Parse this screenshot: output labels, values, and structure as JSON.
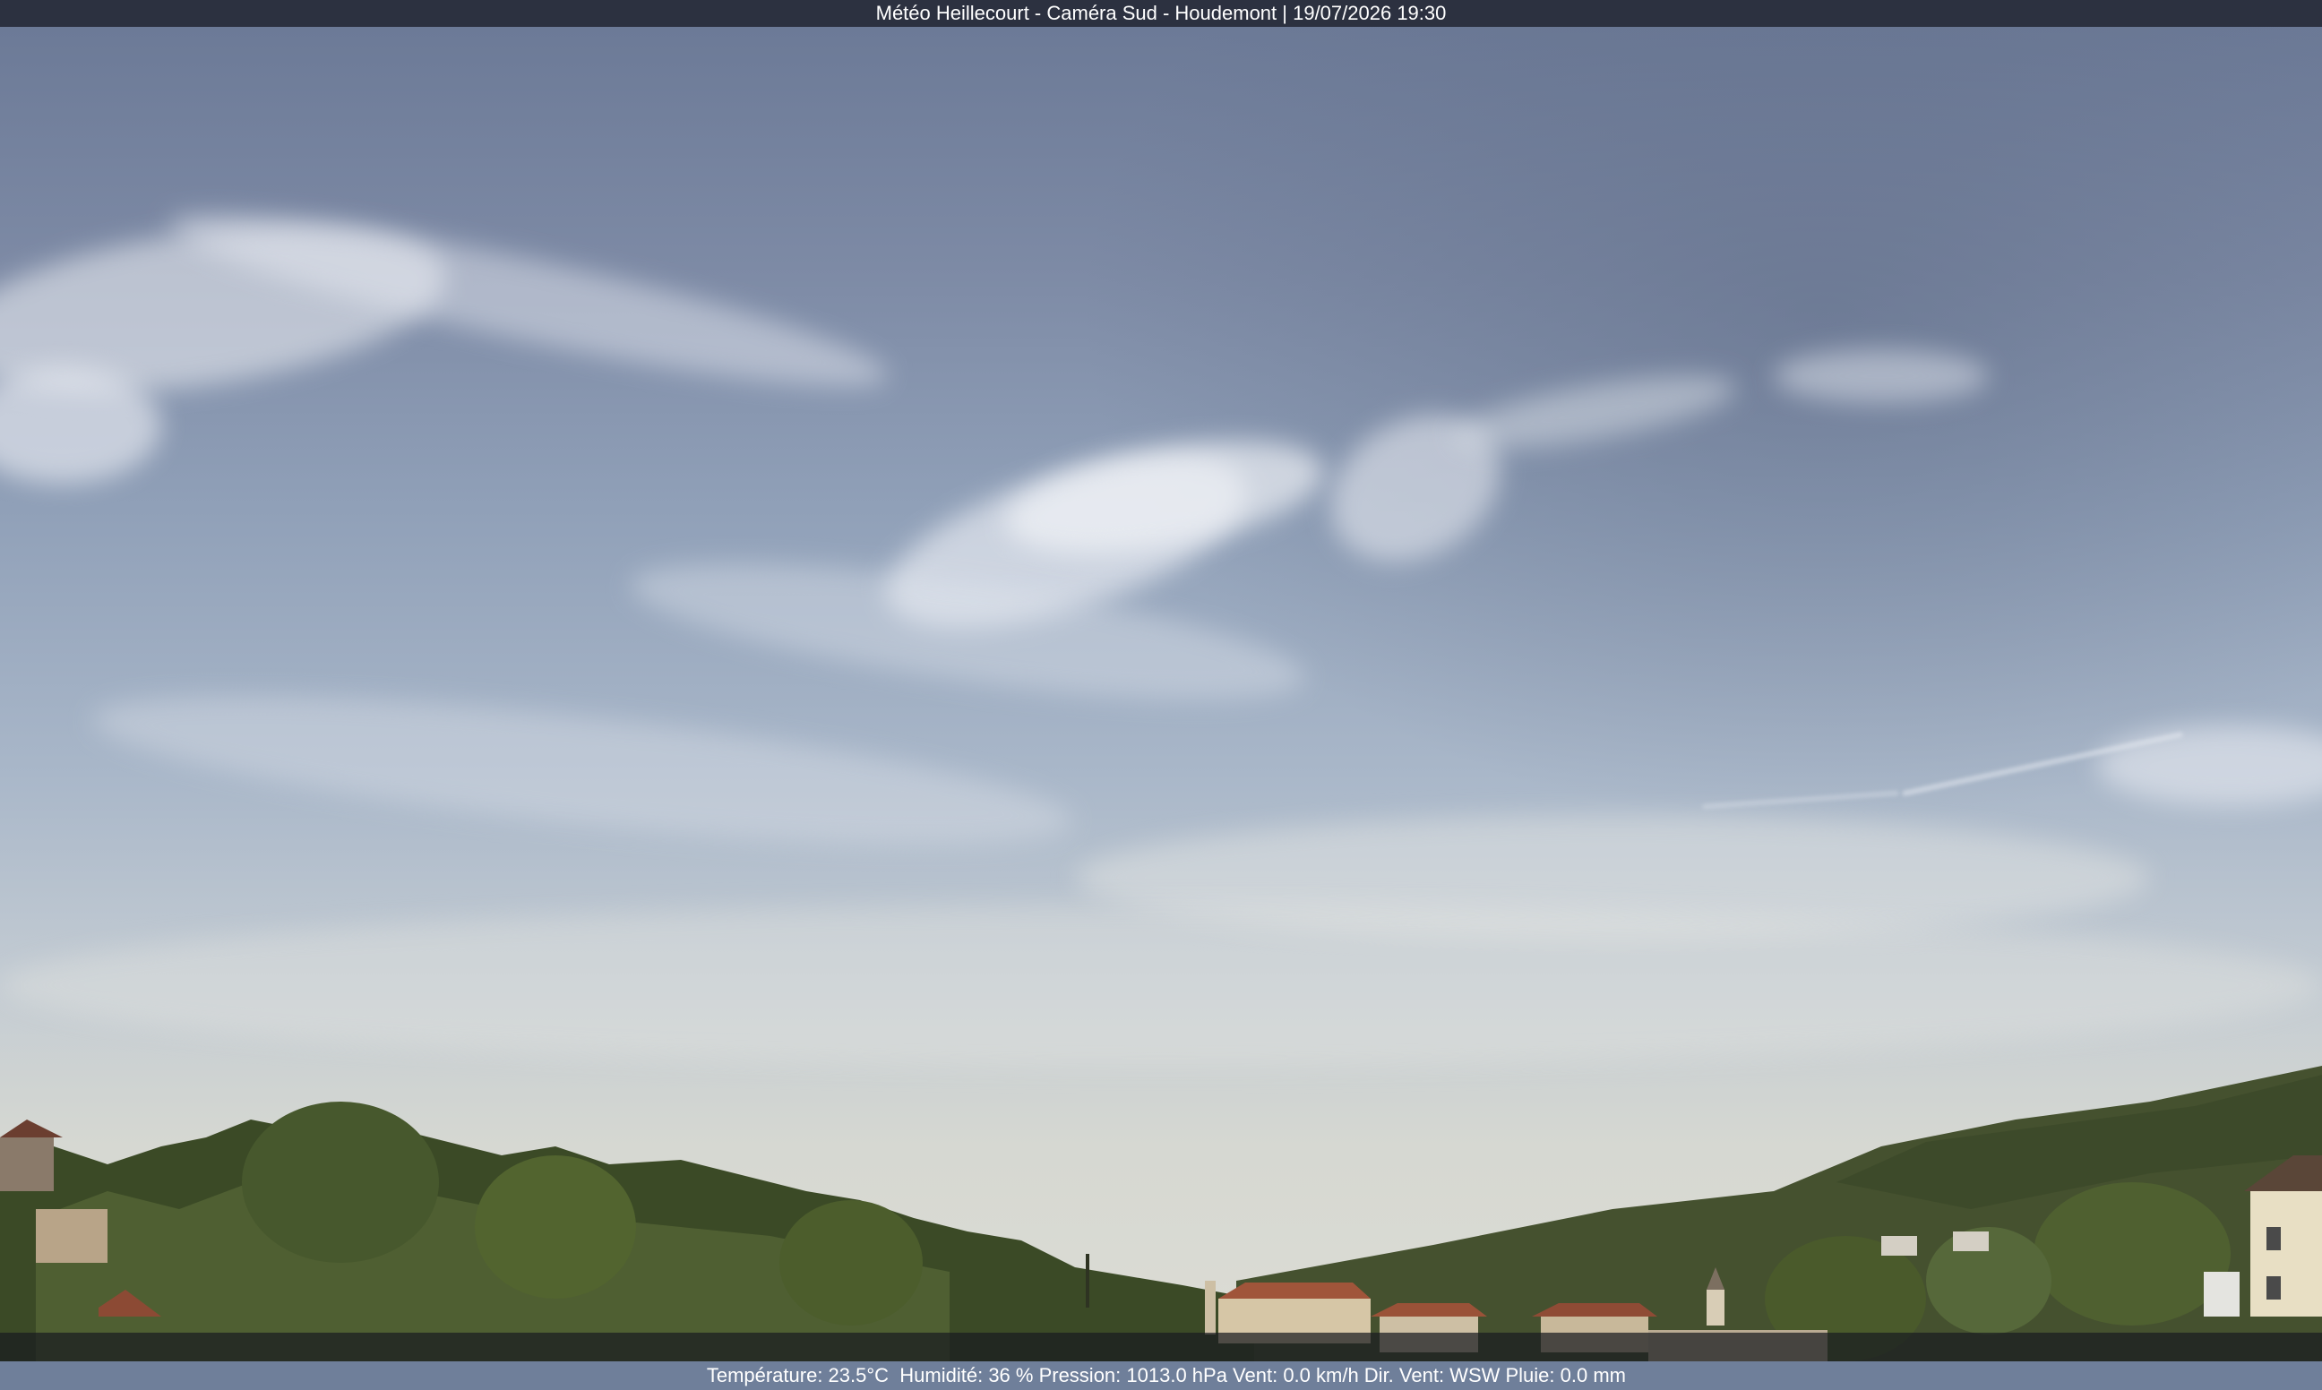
{
  "header": {
    "title": "Météo Heillecourt - Caméra Sud - Houdemont | 19/07/2026 19:30"
  },
  "weather": {
    "line": "Température: 23.5°C  Humidité: 36 % Pression: 1013.0 hPa Vent: 0.0 km/h Dir. Vent: WSW Pluie: 0.0 mm"
  },
  "colors": {
    "sky_top": "#6c7a97",
    "sky_horizon": "#dcdcd4",
    "trees": "#3c4a28",
    "roofs": "#a0553a",
    "bar": "#2c3140"
  }
}
